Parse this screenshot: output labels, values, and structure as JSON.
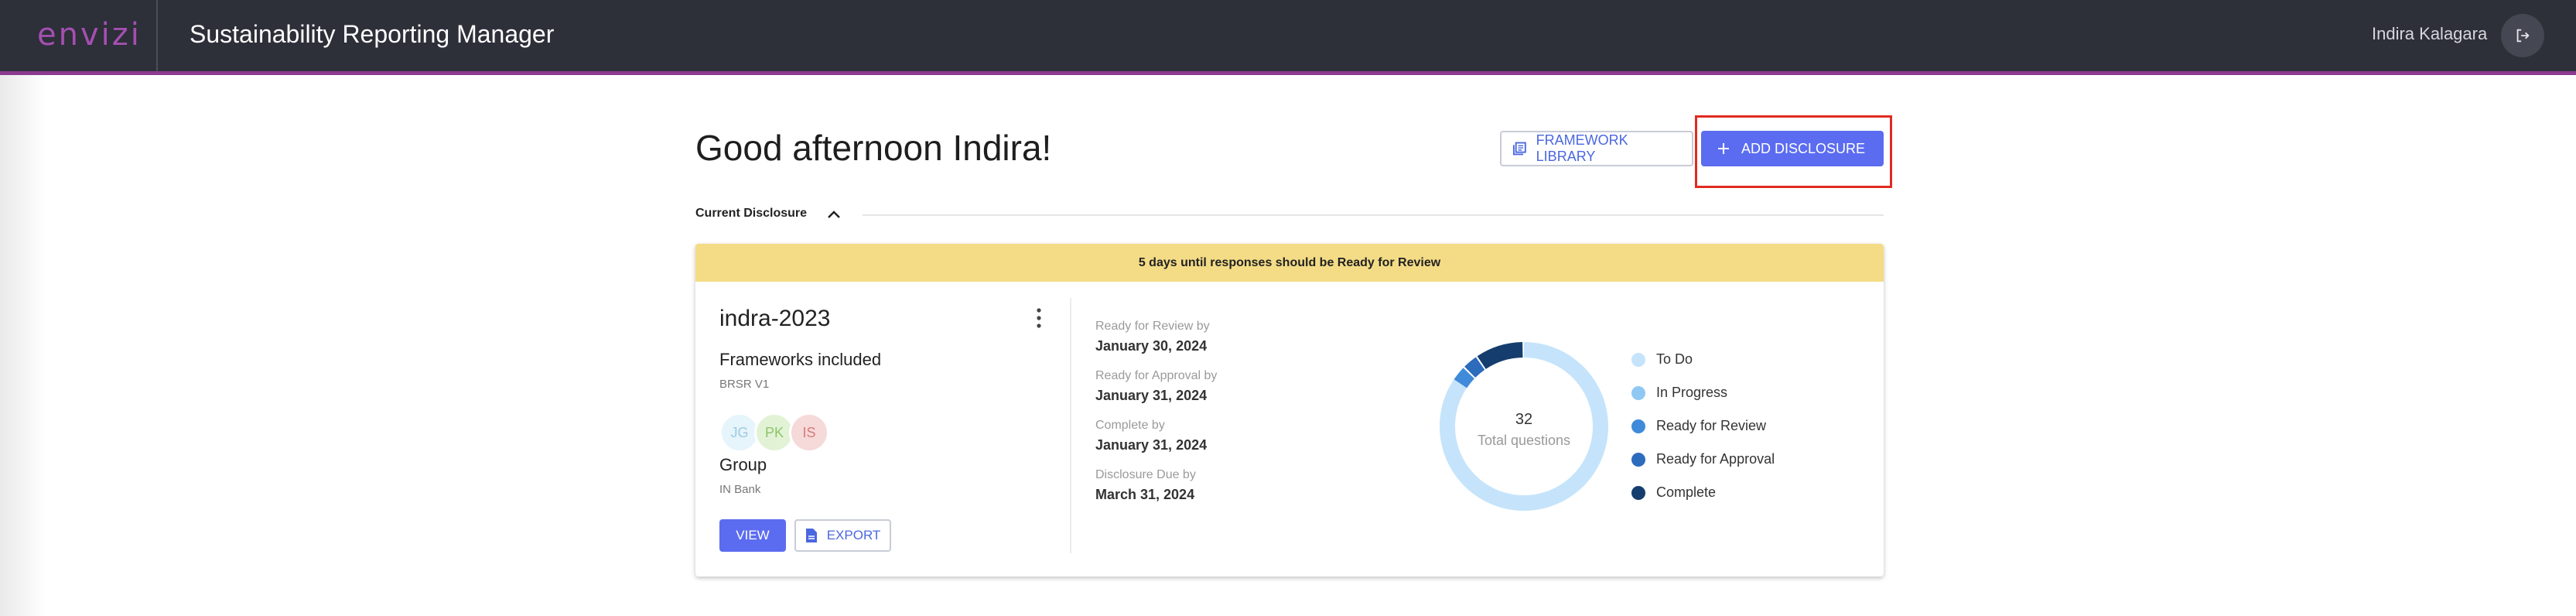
{
  "header": {
    "logo": "envizi",
    "app_title": "Sustainability Reporting Manager",
    "user_name": "Indira Kalagara"
  },
  "main": {
    "greeting": "Good afternoon Indira!",
    "framework_library_label": "FRAMEWORK LIBRARY",
    "add_disclosure_label": "ADD DISCLOSURE",
    "section_label": "Current Disclosure"
  },
  "card": {
    "banner": "5 days until responses should be Ready for Review",
    "title": "indra-2023",
    "frameworks_label": "Frameworks included",
    "frameworks_value": "BRSR V1",
    "avatars": [
      {
        "initials": "JG",
        "bg": "#e6f4fb",
        "fg": "#9ccbe0"
      },
      {
        "initials": "PK",
        "bg": "#e2f3d5",
        "fg": "#8cc56a"
      },
      {
        "initials": "IS",
        "bg": "#f6d9d9",
        "fg": "#d77b7b"
      }
    ],
    "group_label": "Group",
    "group_value": "IN Bank",
    "view_label": "VIEW",
    "export_label": "EXPORT",
    "dates": [
      {
        "label": "Ready for Review by",
        "value": "January 30, 2024"
      },
      {
        "label": "Ready for Approval by",
        "value": "January 31, 2024"
      },
      {
        "label": "Complete by",
        "value": "January 31, 2024"
      },
      {
        "label": "Disclosure Due by",
        "value": "March 31, 2024"
      }
    ],
    "donut": {
      "total": "32",
      "total_label": "Total questions",
      "segments": [
        {
          "name": "To Do",
          "value": 27,
          "color": "#c5e4fb"
        },
        {
          "name": "In Progress",
          "value": 0,
          "color": "#90c8f4"
        },
        {
          "name": "Ready for Review",
          "value": 1,
          "color": "#3f8ad9"
        },
        {
          "name": "Ready for Approval",
          "value": 1,
          "color": "#2d6bbd"
        },
        {
          "name": "Complete",
          "value": 3,
          "color": "#153e6e"
        }
      ]
    },
    "legend": [
      {
        "label": "To Do",
        "color": "#c5e4fb"
      },
      {
        "label": "In Progress",
        "color": "#90c8f4"
      },
      {
        "label": "Ready for Review",
        "color": "#3f8ad9"
      },
      {
        "label": "Ready for Approval",
        "color": "#2d6bbd"
      },
      {
        "label": "Complete",
        "color": "#153e6e"
      }
    ]
  }
}
